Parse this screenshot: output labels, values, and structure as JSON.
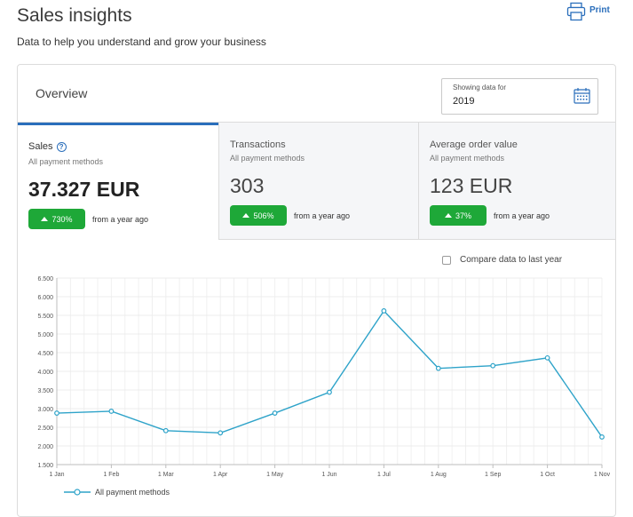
{
  "header": {
    "title": "Sales insights",
    "subtitle": "Data to help you understand and grow your business",
    "print_label": "Print"
  },
  "overview": {
    "title": "Overview",
    "date_picker": {
      "label": "Showing data for",
      "value": "2019"
    }
  },
  "tabs": [
    {
      "title": "Sales",
      "subtitle": "All payment methods",
      "value": "37.327 EUR",
      "change": "730%",
      "compare": "from a year ago",
      "active": true
    },
    {
      "title": "Transactions",
      "subtitle": "All payment methods",
      "value": "303",
      "change": "506%",
      "compare": "from a year ago",
      "active": false
    },
    {
      "title": "Average order value",
      "subtitle": "All payment methods",
      "value": "123 EUR",
      "change": "37%",
      "compare": "from a year ago",
      "active": false
    }
  ],
  "compare_checkbox": {
    "label": "Compare data to last year",
    "checked": false
  },
  "colors": {
    "accent": "#2a6ebb",
    "positive": "#1ea838",
    "series": "#2ea3c9"
  },
  "chart_data": {
    "type": "line",
    "x": [
      "1 Jan",
      "1 Feb",
      "1 Mar",
      "1 Apr",
      "1 May",
      "1 Jun",
      "1 Jul",
      "1 Aug",
      "1 Sep",
      "1 Oct",
      "1 Nov"
    ],
    "series": [
      {
        "name": "All payment methods",
        "values": [
          2880,
          2930,
          2410,
          2350,
          2880,
          3440,
          5620,
          4080,
          4150,
          4360,
          2240
        ]
      }
    ],
    "yticks": [
      "1.500",
      "2.000",
      "2.500",
      "3.000",
      "3.500",
      "4.000",
      "4.500",
      "5.000",
      "5.500",
      "6.000",
      "6.500"
    ],
    "ylim": [
      1500,
      6500
    ],
    "grid": true,
    "legend": "bottom-left"
  }
}
